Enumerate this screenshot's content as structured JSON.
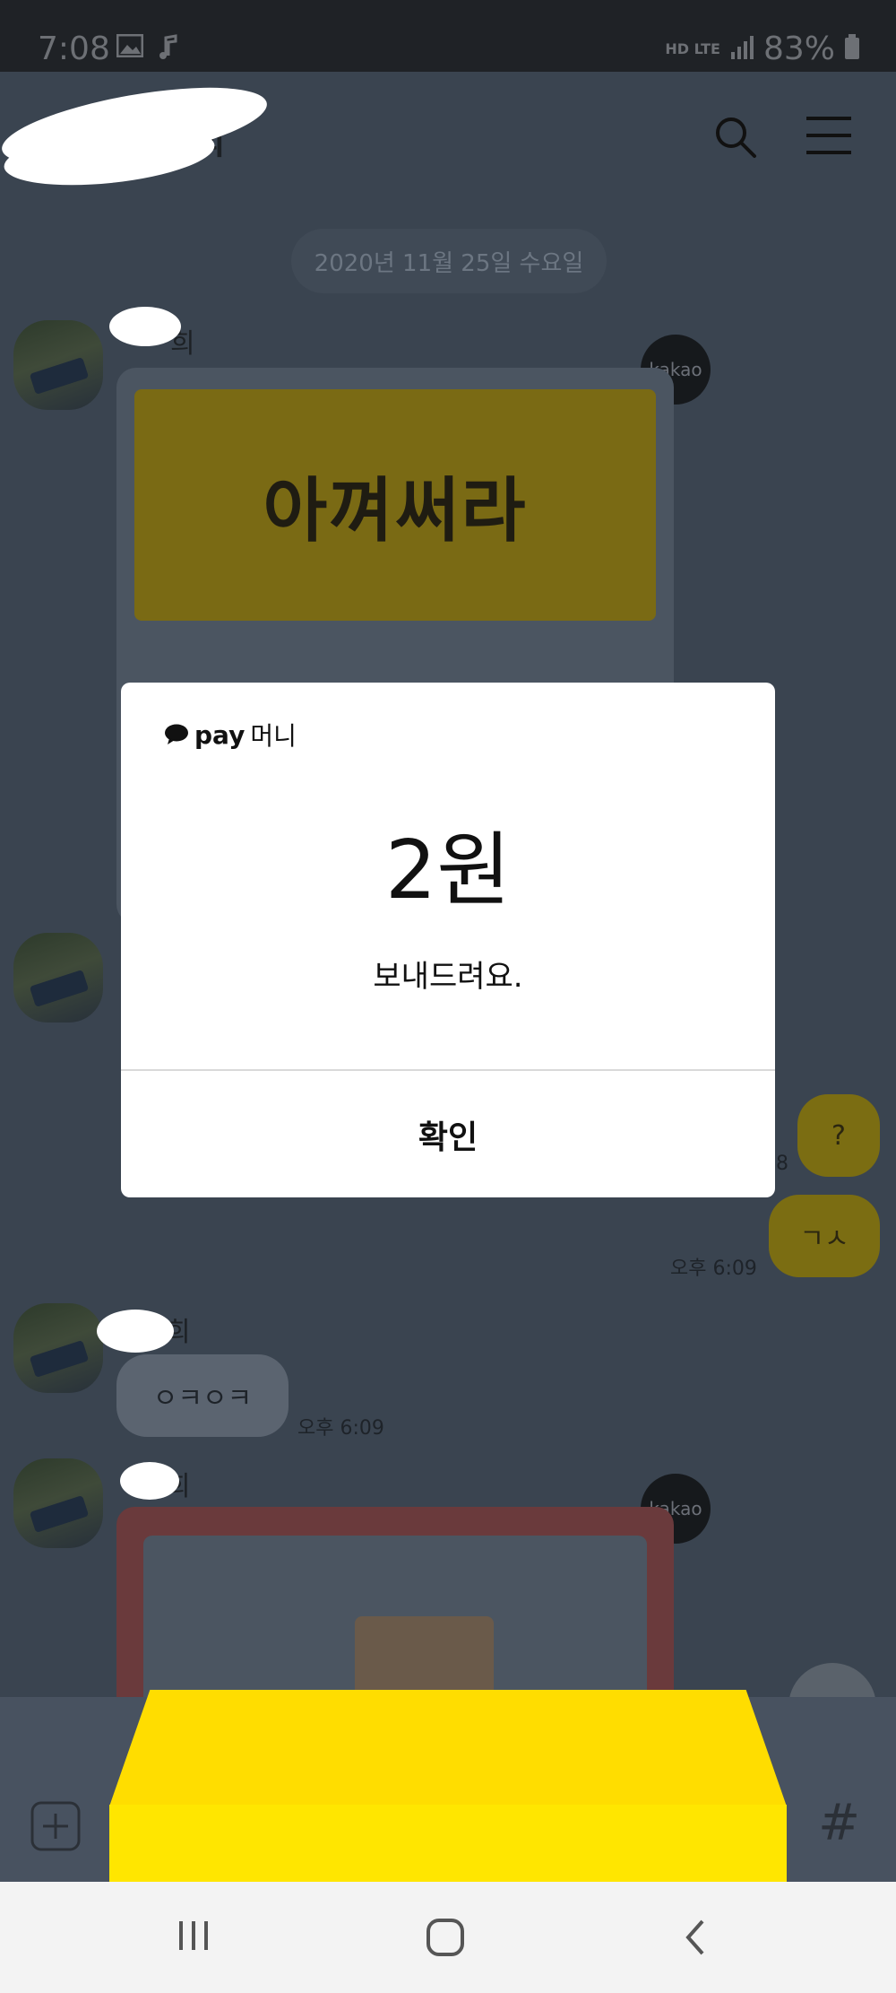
{
  "status_bar": {
    "time": "7:08",
    "network": "HD LTE",
    "battery": "83%"
  },
  "chat": {
    "title_visible": "희",
    "date_separator": "2020년 11월 25일 수요일",
    "sender_suffix_1": "희",
    "sender_suffix_2": "희",
    "sender_suffix_3": "희",
    "badge_label": "kakao",
    "gift_banner_text": "아껴써라",
    "messages": [
      {
        "from": "me",
        "text": "?",
        "time": "8"
      },
      {
        "from": "me",
        "text": "ㄱㅅ",
        "time": "오후 6:09"
      },
      {
        "from": "other",
        "text": "ㅇㅋㅇㅋ",
        "time": "오후 6:09"
      }
    ]
  },
  "input_bar": {
    "hash_label": "#"
  },
  "modal": {
    "brand_pay": "pay",
    "brand_money": "머니",
    "amount": "2원",
    "message": "보내드려요.",
    "confirm_label": "확인"
  },
  "colors": {
    "kakao_yellow": "#ffe600",
    "overlay_bg": "#3a4450",
    "modal_bg": "#ffffff"
  }
}
